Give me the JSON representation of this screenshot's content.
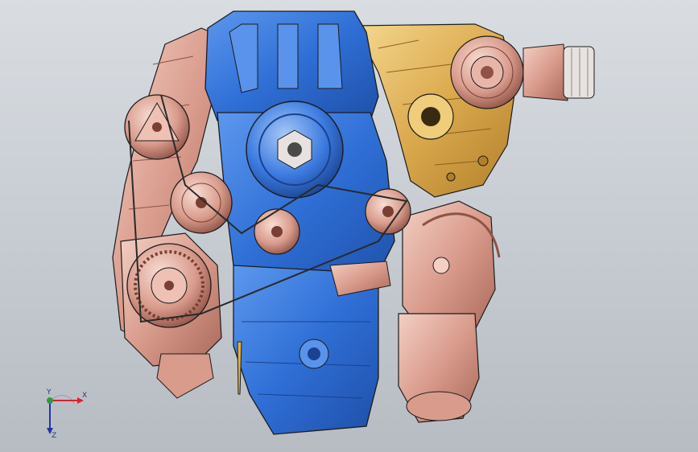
{
  "viewport": {
    "background_top": "#d9dde2",
    "background_bottom": "#b7bcc3"
  },
  "model": {
    "colors": {
      "block_blue": "#2f6fd6",
      "block_blue_light": "#5a93ec",
      "accessory_pink": "#d99b8c",
      "accessory_pink_light": "#efc1b4",
      "bracket_gold": "#d9a64a",
      "bracket_gold_light": "#f0cd7a",
      "edge_dark": "#1c1c1c"
    }
  },
  "triad": {
    "x_label": "X",
    "y_label": "Y",
    "z_label": "Z",
    "x_color": "#d8232a",
    "y_color": "#2e9a3a",
    "z_color": "#2433a6"
  }
}
